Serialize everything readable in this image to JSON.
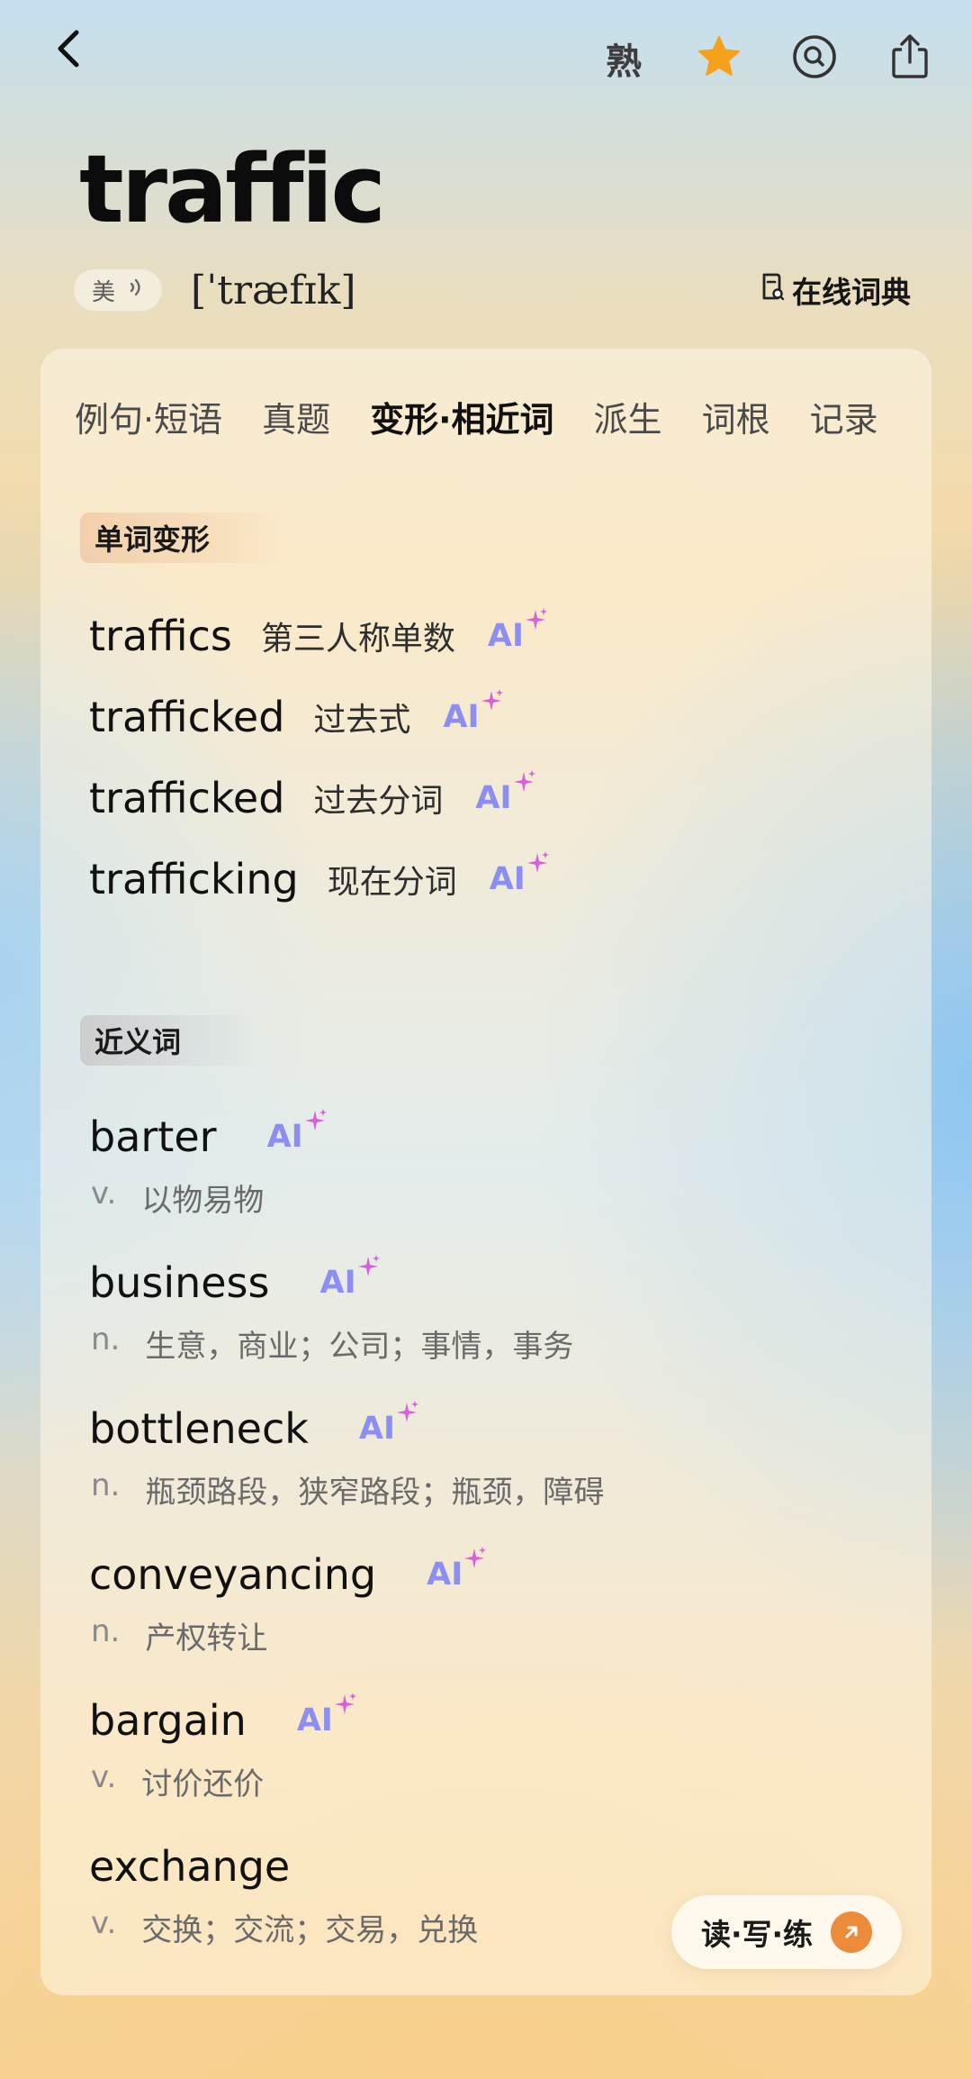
{
  "header": {
    "familiar_label": "熟",
    "icons": [
      "back-icon",
      "star-icon",
      "search-icon",
      "share-icon"
    ],
    "star_color": "#f5a11c"
  },
  "word": {
    "headword": "traffic",
    "accent": "美",
    "phonetic": "[ˈtræfɪk]",
    "online_dict": "在线词典"
  },
  "tabs": [
    {
      "label": "例句·短语",
      "active": false
    },
    {
      "label": "真题",
      "active": false
    },
    {
      "label": "变形·相近词",
      "active": true
    },
    {
      "label": "派生",
      "active": false
    },
    {
      "label": "词根",
      "active": false
    },
    {
      "label": "记录",
      "active": false
    }
  ],
  "forms": {
    "title": "单词变形",
    "items": [
      {
        "word": "traffics",
        "desc": "第三人称单数",
        "ai": "AI"
      },
      {
        "word": "trafficked",
        "desc": "过去式",
        "ai": "AI"
      },
      {
        "word": "trafficked",
        "desc": "过去分词",
        "ai": "AI"
      },
      {
        "word": "trafficking",
        "desc": "现在分词",
        "ai": "AI"
      }
    ]
  },
  "synonyms": {
    "title": "近义词",
    "items": [
      {
        "word": "barter",
        "pos": "v.",
        "def": "以物易物",
        "ai": "AI"
      },
      {
        "word": "business",
        "pos": "n.",
        "def": "生意，商业；公司；事情，事务",
        "ai": "AI"
      },
      {
        "word": "bottleneck",
        "pos": "n.",
        "def": "瓶颈路段，狭窄路段；瓶颈，障碍",
        "ai": "AI"
      },
      {
        "word": "conveyancing",
        "pos": "n.",
        "def": "产权转让",
        "ai": "AI"
      },
      {
        "word": "bargain",
        "pos": "v.",
        "def": "讨价还价",
        "ai": "AI"
      },
      {
        "word": "exchange",
        "pos": "v.",
        "def": "交换；交流；交易，兑换"
      }
    ]
  },
  "practice": {
    "label": "读·写·练",
    "accent_color": "#ec8c3a"
  },
  "ai_color": "#8d8ff0"
}
